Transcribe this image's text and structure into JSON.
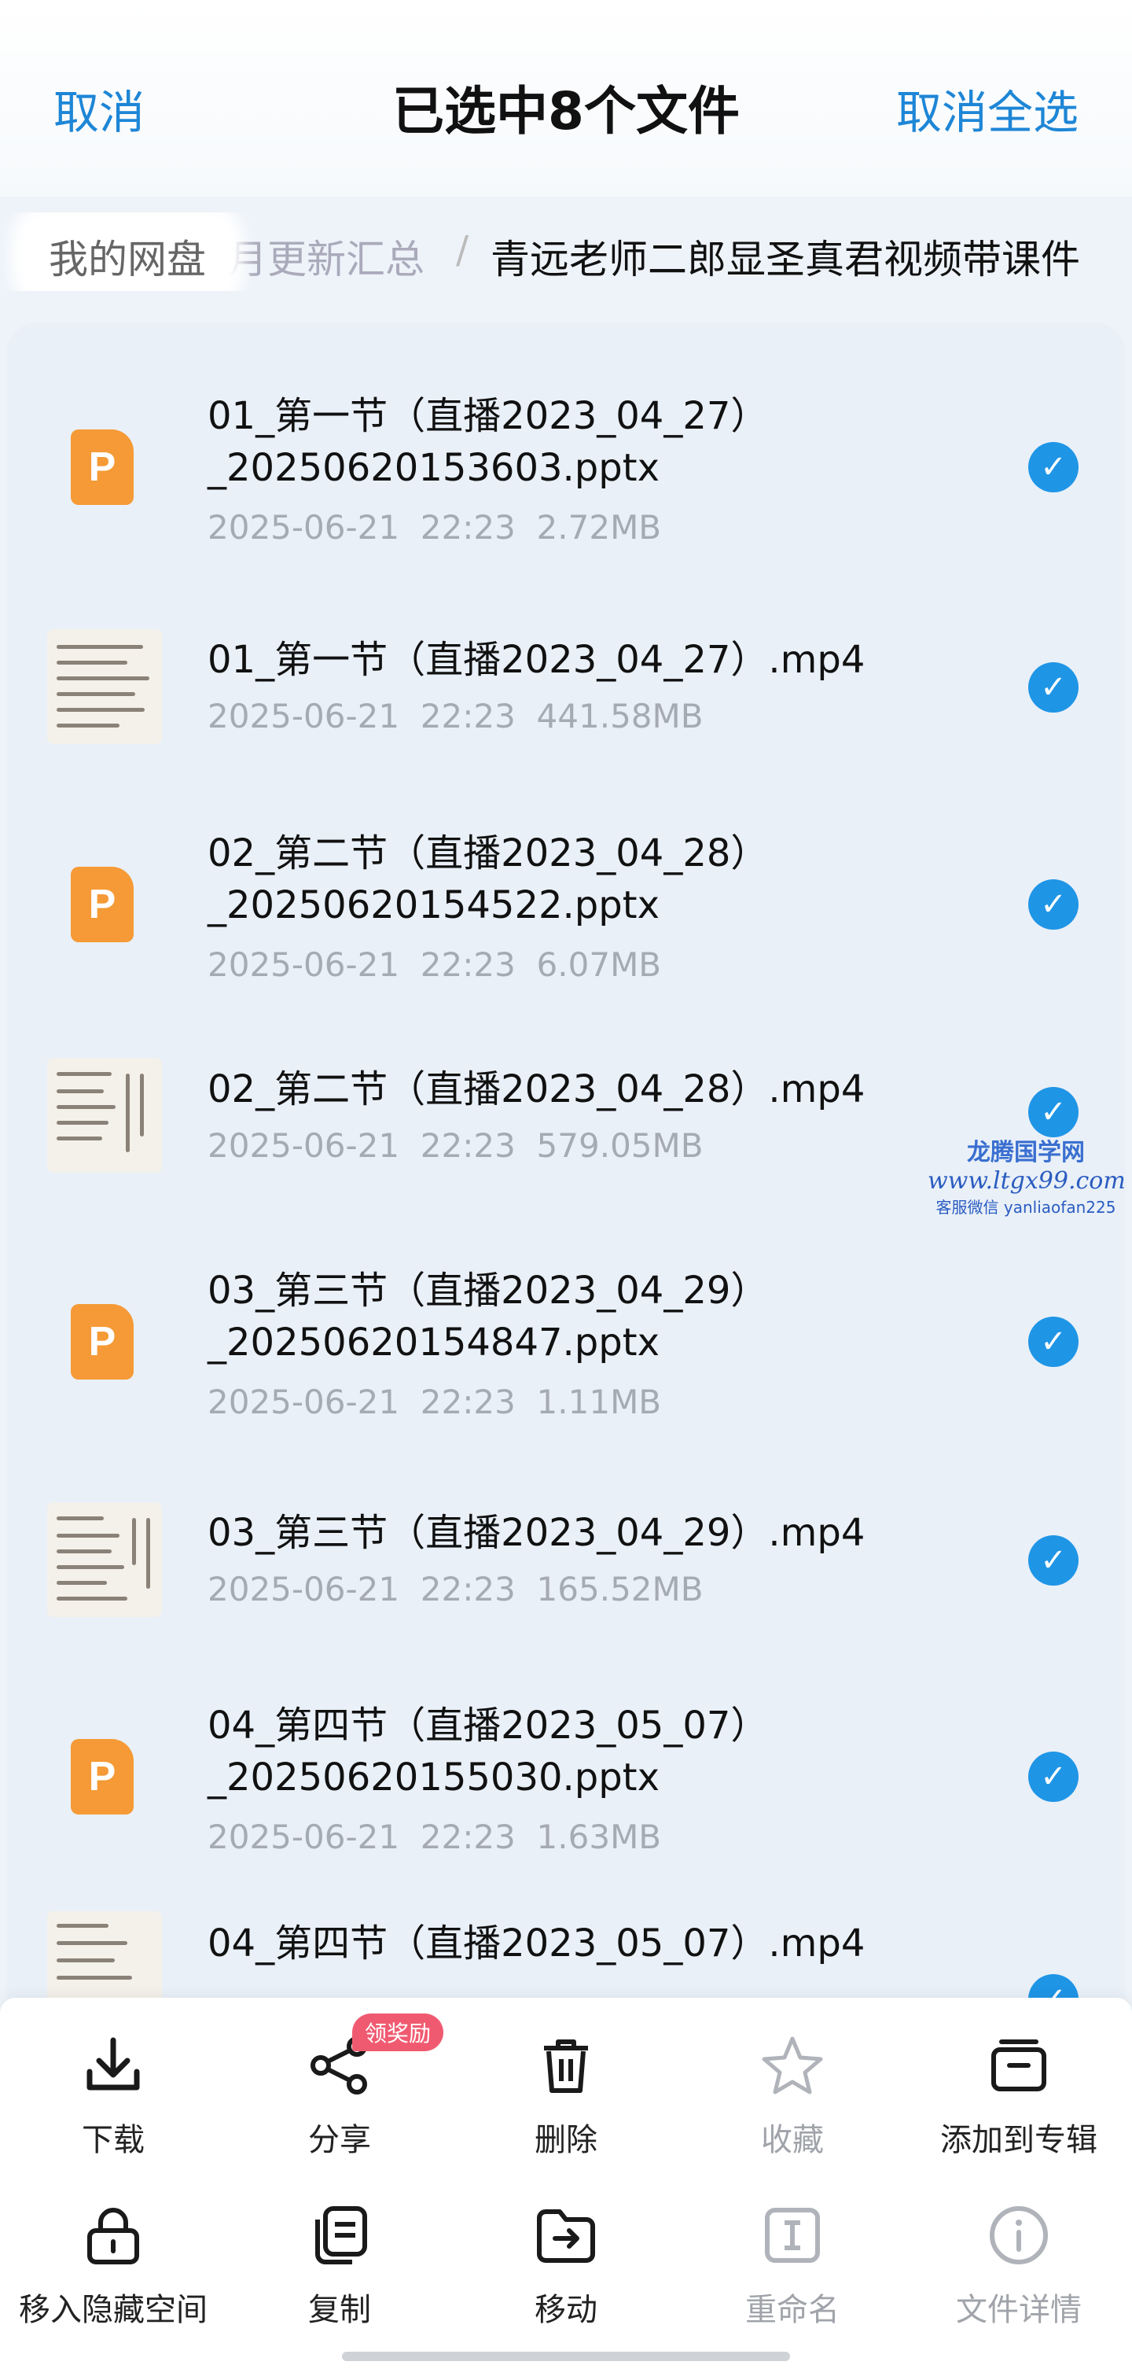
{
  "header": {
    "cancel": "取消",
    "title": "已选中8个文件",
    "cancel_all": "取消全选"
  },
  "breadcrumb": {
    "root": "我的网盘",
    "middle": "月更新汇总",
    "separator": "/",
    "current": "青远老师二郎显圣真君视频带课件"
  },
  "files": [
    {
      "name1": "01_第一节（直播2023_04_27）",
      "name2": "_20250620153603.pptx",
      "date": "2025-06-21",
      "time": "22:23",
      "size": "2.72MB",
      "type": "ppt",
      "ppt_letter": "P"
    },
    {
      "name1": "01_第一节（直播2023_04_27）.mp4",
      "date": "2025-06-21",
      "time": "22:23",
      "size": "441.58MB",
      "type": "video"
    },
    {
      "name1": "02_第二节（直播2023_04_28）",
      "name2": "_20250620154522.pptx",
      "date": "2025-06-21",
      "time": "22:23",
      "size": "6.07MB",
      "type": "ppt",
      "ppt_letter": "P"
    },
    {
      "name1": "02_第二节（直播2023_04_28）.mp4",
      "date": "2025-06-21",
      "time": "22:23",
      "size": "579.05MB",
      "type": "video"
    },
    {
      "name1": "03_第三节（直播2023_04_29）",
      "name2": "_20250620154847.pptx",
      "date": "2025-06-21",
      "time": "22:23",
      "size": "1.11MB",
      "type": "ppt",
      "ppt_letter": "P"
    },
    {
      "name1": "03_第三节（直播2023_04_29）.mp4",
      "date": "2025-06-21",
      "time": "22:23",
      "size": "165.52MB",
      "type": "video"
    },
    {
      "name1": "04_第四节（直播2023_05_07）",
      "name2": "_20250620155030.pptx",
      "date": "2025-06-21",
      "time": "22:23",
      "size": "1.63MB",
      "type": "ppt",
      "ppt_letter": "P"
    },
    {
      "name1": "04_第四节（直播2023_05_07）.mp4",
      "type": "video"
    }
  ],
  "watermark": {
    "line1": "龙腾国学网",
    "line2": "www.ltgx99.com",
    "line3": "客服微信 yanliaofan225"
  },
  "actions": {
    "download": "下载",
    "share": "分享",
    "share_badge": "领奖励",
    "delete": "删除",
    "favorite": "收藏",
    "add_album": "添加到专辑",
    "hide": "移入隐藏空间",
    "copy": "复制",
    "move": "移动",
    "rename": "重命名",
    "details": "文件详情"
  },
  "colors": {
    "accent": "#1e86d6",
    "check": "#1f95e6",
    "ppt": "#f59a36",
    "badge": "#f05a70"
  }
}
